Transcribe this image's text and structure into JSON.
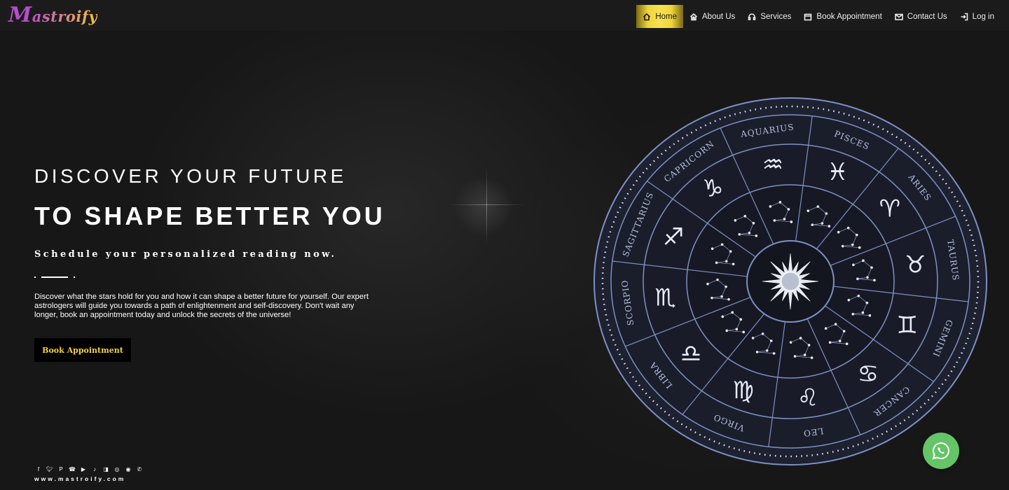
{
  "brand": {
    "logo_initial": "M",
    "logo_rest": "astroify"
  },
  "nav": [
    {
      "label": "Home",
      "icon": "home-icon",
      "active": true
    },
    {
      "label": "About Us",
      "icon": "star-house-icon"
    },
    {
      "label": "Services",
      "icon": "headset-icon"
    },
    {
      "label": "Book Appointment",
      "icon": "calendar-icon"
    },
    {
      "label": "Contact Us",
      "icon": "envelope-icon"
    },
    {
      "label": "Log in",
      "icon": "login-icon"
    }
  ],
  "hero": {
    "line1": "DISCOVER YOUR FUTURE",
    "line2": "TO SHAPE BETTER YOU",
    "subtitle": "Schedule your personalized reading now.",
    "description": "Discover what the stars hold for you and how it can shape a better future for yourself. Our expert astrologers will guide you towards a path of enlightenment and self-discovery. Don't wait any longer, book an appointment today and unlock the secrets of the universe!",
    "cta_label": "Book Appointment"
  },
  "social_icons": [
    "facebook-icon",
    "twitter-icon",
    "pinterest-icon",
    "phone-icon",
    "youtube-icon",
    "tiktok-icon",
    "patreon-icon",
    "instagram-icon",
    "reddit-icon",
    "whatsapp-icon"
  ],
  "website": "www.mastroify.com",
  "zodiac": {
    "signs": [
      "PISCES",
      "ARIES",
      "TAURUS",
      "GEMINI",
      "CANCER",
      "LEO",
      "VIRGO",
      "LIBRA",
      "SCORPIO",
      "SAGITTARIUS",
      "CAPRICORN",
      "AQUARIUS"
    ],
    "glyphs": [
      "♓",
      "♈",
      "♉",
      "♊",
      "♋",
      "♌",
      "♍",
      "♎",
      "♏",
      "♐",
      "♑",
      "♒"
    ]
  },
  "colors": {
    "accent_gold": "#f0d53b",
    "whatsapp_green": "#64c466",
    "wheel_blue": "#7f8fc4"
  }
}
